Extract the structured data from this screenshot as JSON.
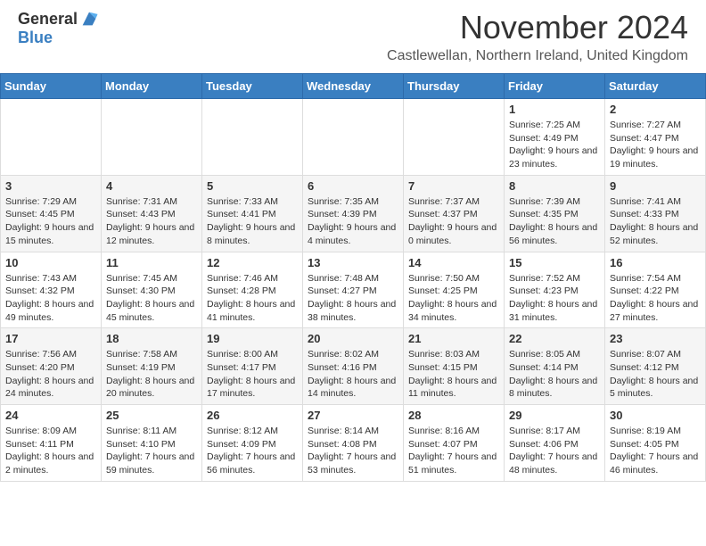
{
  "logo": {
    "general": "General",
    "blue": "Blue"
  },
  "title": "November 2024",
  "location": "Castlewellan, Northern Ireland, United Kingdom",
  "days_of_week": [
    "Sunday",
    "Monday",
    "Tuesday",
    "Wednesday",
    "Thursday",
    "Friday",
    "Saturday"
  ],
  "weeks": [
    {
      "row_class": "row-1",
      "days": [
        {
          "num": "",
          "info": ""
        },
        {
          "num": "",
          "info": ""
        },
        {
          "num": "",
          "info": ""
        },
        {
          "num": "",
          "info": ""
        },
        {
          "num": "",
          "info": ""
        },
        {
          "num": "1",
          "info": "Sunrise: 7:25 AM\nSunset: 4:49 PM\nDaylight: 9 hours and 23 minutes."
        },
        {
          "num": "2",
          "info": "Sunrise: 7:27 AM\nSunset: 4:47 PM\nDaylight: 9 hours and 19 minutes."
        }
      ]
    },
    {
      "row_class": "row-2",
      "days": [
        {
          "num": "3",
          "info": "Sunrise: 7:29 AM\nSunset: 4:45 PM\nDaylight: 9 hours and 15 minutes."
        },
        {
          "num": "4",
          "info": "Sunrise: 7:31 AM\nSunset: 4:43 PM\nDaylight: 9 hours and 12 minutes."
        },
        {
          "num": "5",
          "info": "Sunrise: 7:33 AM\nSunset: 4:41 PM\nDaylight: 9 hours and 8 minutes."
        },
        {
          "num": "6",
          "info": "Sunrise: 7:35 AM\nSunset: 4:39 PM\nDaylight: 9 hours and 4 minutes."
        },
        {
          "num": "7",
          "info": "Sunrise: 7:37 AM\nSunset: 4:37 PM\nDaylight: 9 hours and 0 minutes."
        },
        {
          "num": "8",
          "info": "Sunrise: 7:39 AM\nSunset: 4:35 PM\nDaylight: 8 hours and 56 minutes."
        },
        {
          "num": "9",
          "info": "Sunrise: 7:41 AM\nSunset: 4:33 PM\nDaylight: 8 hours and 52 minutes."
        }
      ]
    },
    {
      "row_class": "row-3",
      "days": [
        {
          "num": "10",
          "info": "Sunrise: 7:43 AM\nSunset: 4:32 PM\nDaylight: 8 hours and 49 minutes."
        },
        {
          "num": "11",
          "info": "Sunrise: 7:45 AM\nSunset: 4:30 PM\nDaylight: 8 hours and 45 minutes."
        },
        {
          "num": "12",
          "info": "Sunrise: 7:46 AM\nSunset: 4:28 PM\nDaylight: 8 hours and 41 minutes."
        },
        {
          "num": "13",
          "info": "Sunrise: 7:48 AM\nSunset: 4:27 PM\nDaylight: 8 hours and 38 minutes."
        },
        {
          "num": "14",
          "info": "Sunrise: 7:50 AM\nSunset: 4:25 PM\nDaylight: 8 hours and 34 minutes."
        },
        {
          "num": "15",
          "info": "Sunrise: 7:52 AM\nSunset: 4:23 PM\nDaylight: 8 hours and 31 minutes."
        },
        {
          "num": "16",
          "info": "Sunrise: 7:54 AM\nSunset: 4:22 PM\nDaylight: 8 hours and 27 minutes."
        }
      ]
    },
    {
      "row_class": "row-4",
      "days": [
        {
          "num": "17",
          "info": "Sunrise: 7:56 AM\nSunset: 4:20 PM\nDaylight: 8 hours and 24 minutes."
        },
        {
          "num": "18",
          "info": "Sunrise: 7:58 AM\nSunset: 4:19 PM\nDaylight: 8 hours and 20 minutes."
        },
        {
          "num": "19",
          "info": "Sunrise: 8:00 AM\nSunset: 4:17 PM\nDaylight: 8 hours and 17 minutes."
        },
        {
          "num": "20",
          "info": "Sunrise: 8:02 AM\nSunset: 4:16 PM\nDaylight: 8 hours and 14 minutes."
        },
        {
          "num": "21",
          "info": "Sunrise: 8:03 AM\nSunset: 4:15 PM\nDaylight: 8 hours and 11 minutes."
        },
        {
          "num": "22",
          "info": "Sunrise: 8:05 AM\nSunset: 4:14 PM\nDaylight: 8 hours and 8 minutes."
        },
        {
          "num": "23",
          "info": "Sunrise: 8:07 AM\nSunset: 4:12 PM\nDaylight: 8 hours and 5 minutes."
        }
      ]
    },
    {
      "row_class": "row-5",
      "days": [
        {
          "num": "24",
          "info": "Sunrise: 8:09 AM\nSunset: 4:11 PM\nDaylight: 8 hours and 2 minutes."
        },
        {
          "num": "25",
          "info": "Sunrise: 8:11 AM\nSunset: 4:10 PM\nDaylight: 7 hours and 59 minutes."
        },
        {
          "num": "26",
          "info": "Sunrise: 8:12 AM\nSunset: 4:09 PM\nDaylight: 7 hours and 56 minutes."
        },
        {
          "num": "27",
          "info": "Sunrise: 8:14 AM\nSunset: 4:08 PM\nDaylight: 7 hours and 53 minutes."
        },
        {
          "num": "28",
          "info": "Sunrise: 8:16 AM\nSunset: 4:07 PM\nDaylight: 7 hours and 51 minutes."
        },
        {
          "num": "29",
          "info": "Sunrise: 8:17 AM\nSunset: 4:06 PM\nDaylight: 7 hours and 48 minutes."
        },
        {
          "num": "30",
          "info": "Sunrise: 8:19 AM\nSunset: 4:05 PM\nDaylight: 7 hours and 46 minutes."
        }
      ]
    }
  ]
}
